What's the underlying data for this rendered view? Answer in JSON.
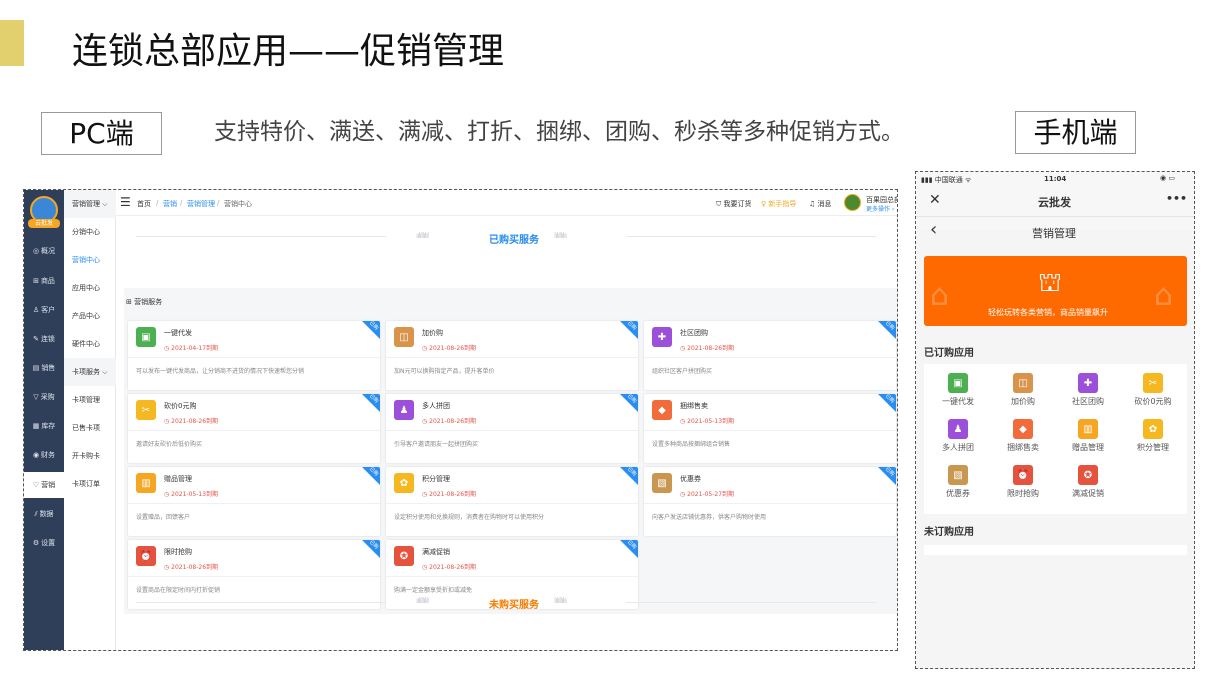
{
  "slide": {
    "title": "连锁总部应用——促销管理",
    "pc_label": "PC端",
    "mobile_label": "手机端",
    "subtitle": "支持特价、满送、满减、打折、捆绑、团购、秒杀等多种促销方式。"
  },
  "pc": {
    "logo_badge": "云批发",
    "sidebar": [
      {
        "icon": "◎",
        "label": "概况"
      },
      {
        "icon": "⊞",
        "label": "商品"
      },
      {
        "icon": "♙",
        "label": "客户"
      },
      {
        "icon": "✎",
        "label": "连锁"
      },
      {
        "icon": "▤",
        "label": "销售"
      },
      {
        "icon": "▽",
        "label": "采购"
      },
      {
        "icon": "▦",
        "label": "库存"
      },
      {
        "icon": "◉",
        "label": "财务"
      },
      {
        "icon": "♡",
        "label": "营销"
      },
      {
        "icon": "⫽",
        "label": "数据"
      },
      {
        "icon": "⚙",
        "label": "设置"
      }
    ],
    "submenu": [
      {
        "label": "营销管理 ⌵",
        "group": true
      },
      {
        "label": "分销中心"
      },
      {
        "label": "营销中心",
        "active": true
      },
      {
        "label": "应用中心"
      },
      {
        "label": "产品中心"
      },
      {
        "label": "硬件中心"
      },
      {
        "label": "卡项服务 ⌵",
        "group": true
      },
      {
        "label": "卡项管理"
      },
      {
        "label": "已售卡项"
      },
      {
        "label": "开卡购卡"
      },
      {
        "label": "卡项订单"
      }
    ],
    "topbar": {
      "menu_icon": "☰",
      "crumb_home": "首页",
      "crumb_1": "营销",
      "crumb_2": "营销管理",
      "crumb_3": "营销中心",
      "sep": "/",
      "order": "我要订货",
      "guide": "新手指导",
      "message": "消息",
      "store": "百果园总部",
      "more": "更多操作 ›"
    },
    "bought_title": "已购买服务",
    "panel_title": "营销服务",
    "unbought_title": "未购买服务",
    "corner_tag": "已购",
    "cards": [
      {
        "name": "一键代发",
        "date": "2021-04-17到期",
        "desc": "可以发布一键代发商品，让分销商不进货的情况下快速帮您分销",
        "color": "#4caf50",
        "icon": "▣"
      },
      {
        "name": "加价购",
        "date": "2021-08-26到期",
        "desc": "加N元可以换购指定产品，提升客单价",
        "color": "#d8944a",
        "icon": "◫"
      },
      {
        "name": "社区团购",
        "date": "2021-08-26到期",
        "desc": "组织社区客户拼团购买",
        "color": "#9c4fd9",
        "icon": "✚"
      },
      {
        "name": "砍价0元购",
        "date": "2021-08-26到期",
        "desc": "邀请好友砍价后低价购买",
        "color": "#f5b821",
        "icon": "✂"
      },
      {
        "name": "多人拼团",
        "date": "2021-08-26到期",
        "desc": "引导客户邀请朋友一起拼团购买",
        "color": "#9c4fd9",
        "icon": "♟"
      },
      {
        "name": "捆绑售卖",
        "date": "2021-05-13到期",
        "desc": "设置多种商品按捆绑组合销售",
        "color": "#f26b3a",
        "icon": "◆"
      },
      {
        "name": "赠品管理",
        "date": "2021-05-13到期",
        "desc": "设置赠品，回馈客户",
        "color": "#f5a623",
        "icon": "▥"
      },
      {
        "name": "积分管理",
        "date": "2021-08-26到期",
        "desc": "设定积分使用和兑换规则，消费者在购物时可以使用积分",
        "color": "#f5b821",
        "icon": "✿"
      },
      {
        "name": "优惠券",
        "date": "2021-05-27到期",
        "desc": "向客户发送店铺优惠券，供客户购物时使用",
        "color": "#c9974f",
        "icon": "▧"
      },
      {
        "name": "限时抢购",
        "date": "2021-08-26到期",
        "desc": "设置商品在限定时间内打折促销",
        "color": "#e5533f",
        "icon": "⏰"
      },
      {
        "name": "满减促销",
        "date": "2021-08-26到期",
        "desc": "购满一定金额享受折扣或减免",
        "color": "#e5533f",
        "icon": "✪"
      }
    ]
  },
  "mobile": {
    "status_carrier": "中国联通",
    "status_time": "11:04",
    "status_right": "◉ ▭",
    "app_title": "云批发",
    "close_icon": "✕",
    "more_icon": "•••",
    "back_icon": "‹",
    "page_title": "营销管理",
    "banner_text": "轻松玩转各类营销，商品销量飙升",
    "ordered_title": "已订购应用",
    "unordered_title": "未订购应用",
    "apps": [
      {
        "label": "一键代发",
        "color": "#4caf50",
        "icon": "▣"
      },
      {
        "label": "加价购",
        "color": "#d8944a",
        "icon": "◫"
      },
      {
        "label": "社区团购",
        "color": "#9c4fd9",
        "icon": "✚"
      },
      {
        "label": "砍价0元购",
        "color": "#f5b821",
        "icon": "✂"
      },
      {
        "label": "多人拼团",
        "color": "#9c4fd9",
        "icon": "♟"
      },
      {
        "label": "捆绑售卖",
        "color": "#f26b3a",
        "icon": "◆"
      },
      {
        "label": "赠品管理",
        "color": "#f5a623",
        "icon": "▥"
      },
      {
        "label": "积分管理",
        "color": "#f5b821",
        "icon": "✿"
      },
      {
        "label": "优惠券",
        "color": "#c9974f",
        "icon": "▧"
      },
      {
        "label": "限时抢购",
        "color": "#e5533f",
        "icon": "⏰"
      },
      {
        "label": "满减促销",
        "color": "#e5533f",
        "icon": "✪"
      }
    ]
  },
  "colors": {
    "bought": "#2a8df0",
    "unbought": "#f57c00",
    "sidebar": "#2f3f5a",
    "banner": "#ff6a00"
  }
}
